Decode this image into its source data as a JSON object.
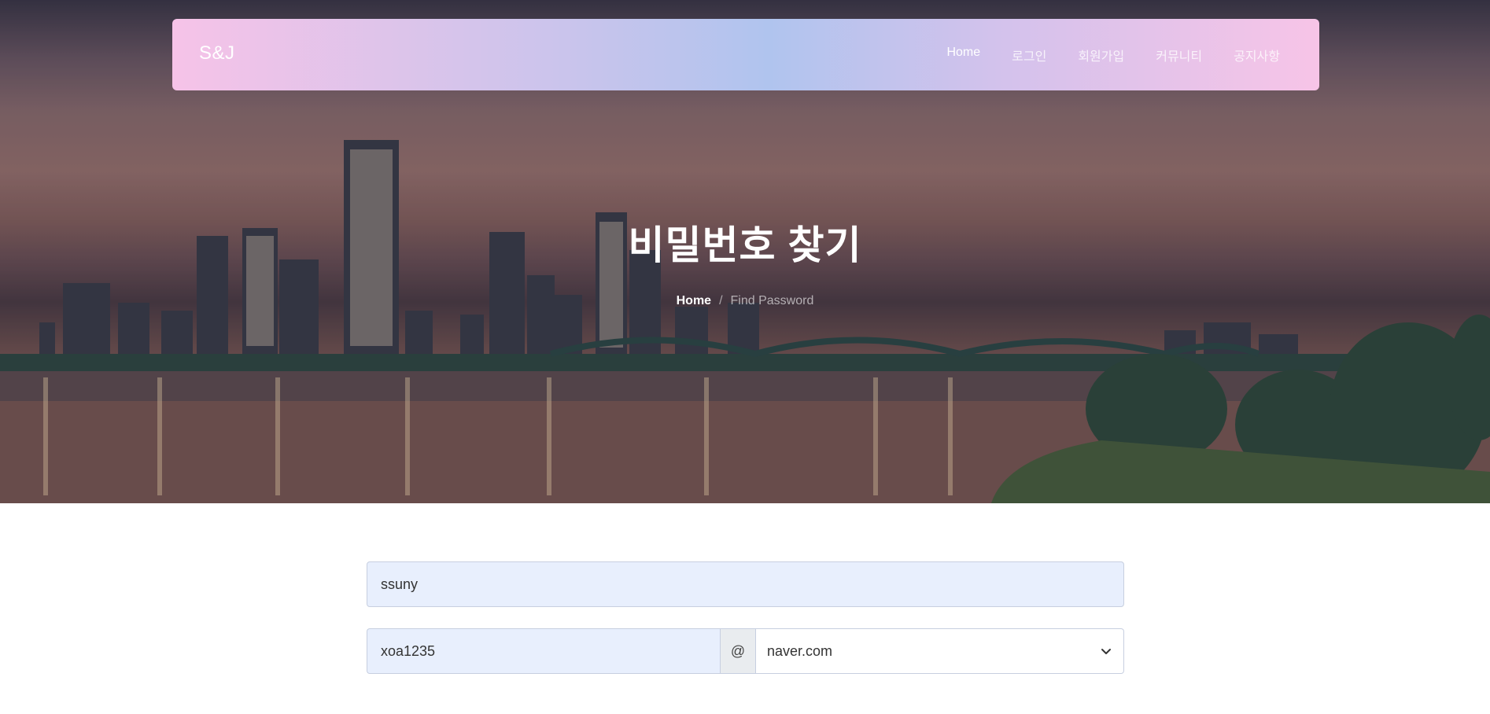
{
  "brand": "S&J",
  "nav": {
    "items": [
      {
        "label": "Home",
        "active": true
      },
      {
        "label": "로그인",
        "active": false
      },
      {
        "label": "회원가입",
        "active": false
      },
      {
        "label": "커뮤니티",
        "active": false
      },
      {
        "label": "공지사항",
        "active": false
      }
    ]
  },
  "hero": {
    "title": "비밀번호 찾기",
    "breadcrumb": {
      "home": "Home",
      "separator": "/",
      "current": "Find Password"
    }
  },
  "form": {
    "user_id": {
      "value": "ssuny"
    },
    "email_local": {
      "value": "xoa1235"
    },
    "at_symbol": "@",
    "email_domain": {
      "selected": "naver.com"
    }
  },
  "icons": {
    "select_caret": "chevron-down-icon"
  }
}
